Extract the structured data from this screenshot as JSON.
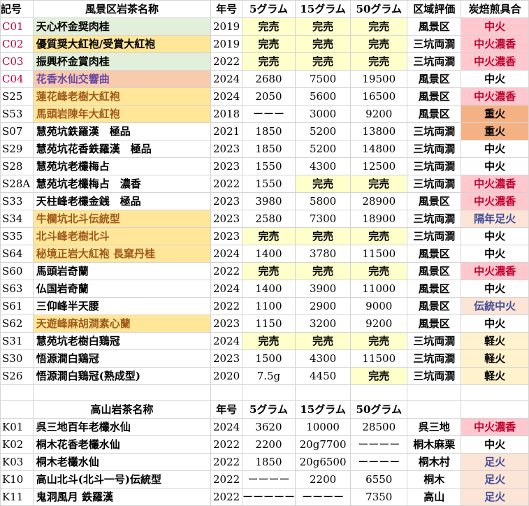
{
  "header1": [
    "記号",
    "風景区岩茶名称",
    "年号",
    "5グラム",
    "15グラム",
    "50グラム",
    "区域評価",
    "炭焙煎具合"
  ],
  "rows1": [
    [
      "C01",
      "天心杯金奨肉桂",
      "2019",
      "完売",
      "完売",
      "完売",
      "風景区",
      "中火"
    ],
    [
      "C02",
      "優質奨大紅袍/受賞大紅袍",
      "2019",
      "完売",
      "完売",
      "完売",
      "三坑両澗",
      "中火濃香"
    ],
    [
      "C03",
      "振興杯金賞肉桂",
      "2022",
      "完売",
      "完売",
      "完売",
      "三坑両澗",
      "中火濃香"
    ],
    [
      "C04",
      "花香水仙交響曲",
      "2024",
      "2680",
      "7500",
      "19500",
      "風景区",
      "中火"
    ],
    [
      "S25",
      "蓮花峰老樹大紅袍",
      "2024",
      "2050",
      "5600",
      "16500",
      "風景区",
      "中火濃香"
    ],
    [
      "S53",
      "馬頭岩陳年大紅袍",
      "2018",
      "ーーー",
      "3000",
      "9200",
      "風景区",
      "重火"
    ],
    [
      "S07",
      "慧苑坑鉄羅漢　極品",
      "2021",
      "1850",
      "5200",
      "13800",
      "三坑両澗",
      "重火"
    ],
    [
      "S29",
      "慧苑坑花香鉄羅漢　極品",
      "2023",
      "1850",
      "5200",
      "14800",
      "三坑両澗",
      "中火"
    ],
    [
      "S28",
      "慧苑坑老欉梅占",
      "2023",
      "1550",
      "4300",
      "12500",
      "三坑両澗",
      "中火"
    ],
    [
      "S28A",
      "慧苑坑老欉梅占　濃香",
      "2022",
      "1550",
      "完売",
      "完売",
      "三坑両澗",
      "中火濃香"
    ],
    [
      "S33",
      "天柱峰老欉金銭　極品",
      "2023",
      "3980",
      "5800",
      "28900",
      "風景区",
      "中火濃香"
    ],
    [
      "S34",
      "牛欄坑北斗伝統型",
      "2023",
      "2580",
      "7300",
      "18900",
      "三坑両澗",
      "隔年足火"
    ],
    [
      "S35",
      "北斗峰老樹北斗",
      "2023",
      "完売",
      "完売",
      "完売",
      "三坑両澗",
      "中火"
    ],
    [
      "S64",
      "秘境正岩大紅袍 長窠丹桂",
      "2024",
      "1400",
      "3780",
      "11500",
      "風景区",
      "中火"
    ],
    [
      "S60",
      "馬頭岩奇蘭",
      "2022",
      "完売",
      "完売",
      "完売",
      "風景区",
      "中火濃香"
    ],
    [
      "S63",
      "仏国岩奇蘭",
      "2024",
      "1400",
      "3900",
      "11000",
      "風景区",
      "中火"
    ],
    [
      "S61",
      "三仰峰半天腰",
      "2022",
      "1100",
      "2900",
      "9000",
      "風景区",
      "伝統中火"
    ],
    [
      "S62",
      "天遊峰麻胡澗素心蘭",
      "2023",
      "1150",
      "3200",
      "9200",
      "風景区",
      "中火"
    ],
    [
      "S31",
      "慧苑坑老樹白鶏冠",
      "2024",
      "完売",
      "完売",
      "完売",
      "三坑両澗",
      "軽火"
    ],
    [
      "S30",
      "悟源澗白鶏冠",
      "2023",
      "1500",
      "4300",
      "11500",
      "三坑両澗",
      "軽火"
    ],
    [
      "S26",
      "悟源澗白鶏冠(熟成型)",
      "2020",
      "7.5g",
      "4450",
      "完売",
      "三坑両澗",
      "軽火"
    ]
  ],
  "header2": [
    "",
    "高山岩茶名称",
    "年号",
    "5グラム",
    "15グラム",
    "50グラム",
    "",
    ""
  ],
  "rows2": [
    [
      "K01",
      "呉三地百年老欉水仙",
      "2024",
      "3620",
      "10000",
      "28500",
      "呉三地",
      "中火濃香"
    ],
    [
      "K02",
      "桐木花香老欉水仙",
      "2022",
      "2200",
      "20g7700",
      "ーーーー",
      "桐木麻栗",
      "中火"
    ],
    [
      "K03",
      "桐木老欉水仙",
      "2022",
      "1850",
      "20g6500",
      "ーーーー",
      "桐木村",
      "足火"
    ],
    [
      "K10",
      "高山北斗(北斗一号)伝統型",
      "2022",
      "ーーーー",
      "2200",
      "6550",
      "桐木",
      "足火"
    ],
    [
      "K11",
      "鬼洞風月 鉄羅漢",
      "2022",
      "ーーーーー",
      "ーーーー",
      "7350",
      "高山",
      "足火"
    ]
  ]
}
